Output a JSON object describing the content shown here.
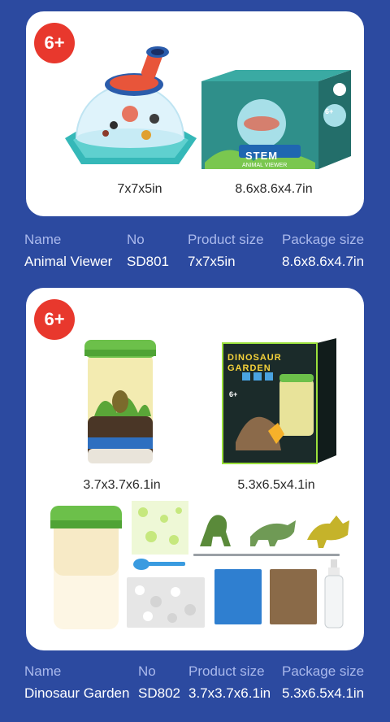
{
  "badge_age": "6+",
  "products": [
    {
      "name": "Animal Viewer",
      "no": "SD801",
      "product_size": "7x7x5in",
      "package_size": "8.6x8.6x4.7in",
      "box_title": "STEM",
      "box_subtitle": "ANIMAL VIEWER"
    },
    {
      "name": "Dinosaur Garden",
      "no": "SD802",
      "product_size": "3.7x3.7x6.1in",
      "package_size": "5.3x6.5x4.1in",
      "box_title_1": "DINOSAUR",
      "box_title_2": "GARDEN"
    }
  ],
  "spec_headers": {
    "name": "Name",
    "no": "No",
    "product_size": "Product size",
    "package_size": "Package size"
  },
  "colors": {
    "background": "#2c4aa0",
    "badge": "#e8382d",
    "header_text": "#aab9ec",
    "lid_green": "#6cc04a",
    "teal": "#3bbfc2"
  }
}
